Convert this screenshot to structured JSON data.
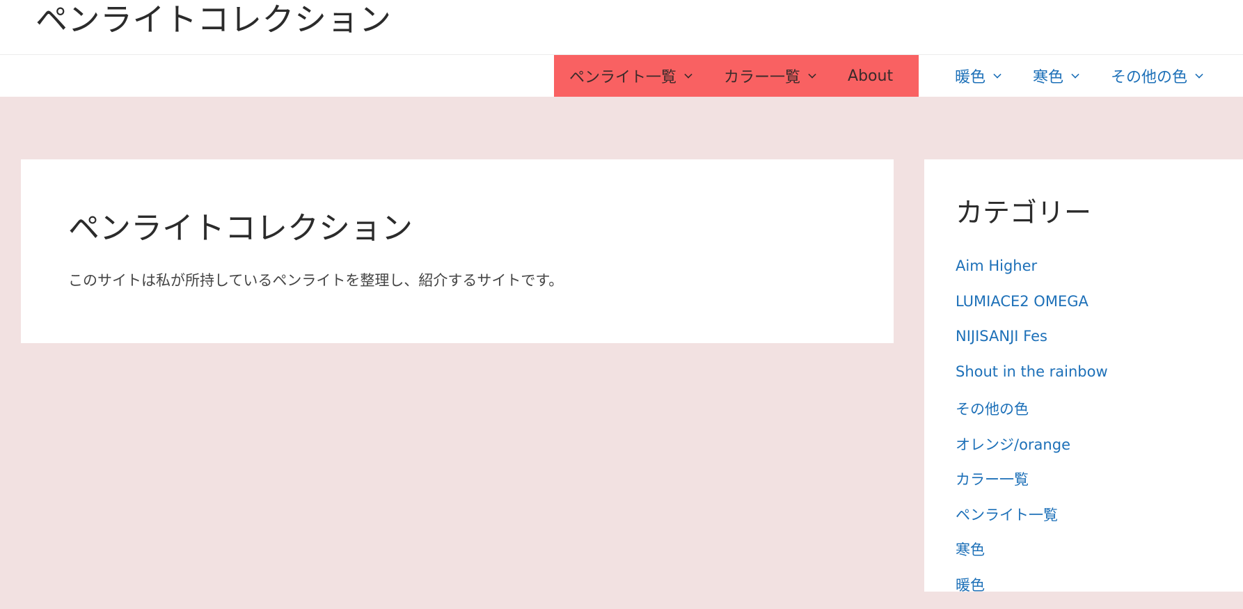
{
  "header": {
    "site_title": "ペンライトコレクション"
  },
  "nav": {
    "primary": [
      {
        "label": "ペンライト一覧",
        "has_dropdown": true
      },
      {
        "label": "カラー一覧",
        "has_dropdown": true
      },
      {
        "label": "About",
        "has_dropdown": false
      }
    ],
    "secondary": [
      {
        "label": "暖色",
        "has_dropdown": true
      },
      {
        "label": "寒色",
        "has_dropdown": true
      },
      {
        "label": "その他の色",
        "has_dropdown": true
      }
    ]
  },
  "main": {
    "heading": "ペンライトコレクション",
    "description": "このサイトは私が所持しているペンライトを整理し、紹介するサイトです。"
  },
  "sidebar": {
    "title": "カテゴリー",
    "categories": [
      "Aim Higher",
      "LUMIACE2 OMEGA",
      "NIJISANJI Fes",
      "Shout in the rainbow",
      "その他の色",
      "オレンジ/orange",
      "カラー一覧",
      "ペンライト一覧",
      "寒色",
      "暖色"
    ]
  },
  "colors": {
    "background": "#f2e1e1",
    "primary_menu_bg": "#f96162",
    "link": "#1d70b8",
    "text": "#2b2b2b"
  }
}
